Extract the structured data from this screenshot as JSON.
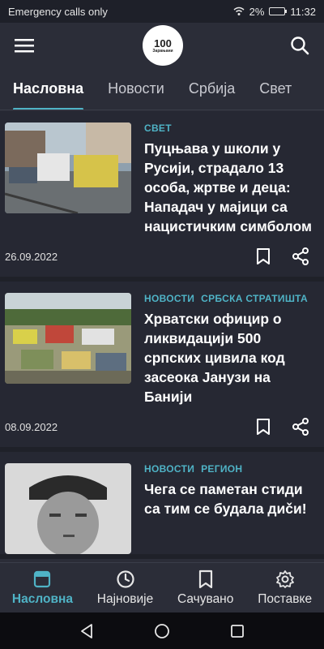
{
  "status_bar": {
    "carrier": "Emergency calls only",
    "battery": "2%",
    "time": "11:32"
  },
  "app_bar": {
    "logo_text": "100",
    "logo_sub": "Зарањани"
  },
  "tabs": [
    {
      "label": "Насловна",
      "active": true
    },
    {
      "label": "Новости",
      "active": false
    },
    {
      "label": "Србија",
      "active": false
    },
    {
      "label": "Свет",
      "active": false
    }
  ],
  "articles": [
    {
      "categories": [
        "СВЕТ"
      ],
      "title": "Пуцњава у школи у Русији, страдало 13 особа, жртве и деца: Нападач у мајици са нацистичким симболом",
      "date": "26.09.2022"
    },
    {
      "categories": [
        "НОВОСТИ",
        "СРБСКА СТРАТИШТА"
      ],
      "title": "Хрватски официр о ликвидацији 500 српских цивила код засеока Јанузи на Банији",
      "date": "08.09.2022"
    },
    {
      "categories": [
        "НОВОСТИ",
        "РЕГИОН"
      ],
      "title": "Чега се паметан стиди са тим се будала диčи!",
      "date": ""
    }
  ],
  "bottom_nav": [
    {
      "label": "Насловна",
      "icon": "home-icon",
      "active": true
    },
    {
      "label": "Најновије",
      "icon": "clock-icon",
      "active": false
    },
    {
      "label": "Сачувано",
      "icon": "bookmark-icon",
      "active": false
    },
    {
      "label": "Поставке",
      "icon": "gear-icon",
      "active": false
    }
  ],
  "colors": {
    "accent": "#4fb3c6",
    "background": "#2b2d38"
  }
}
